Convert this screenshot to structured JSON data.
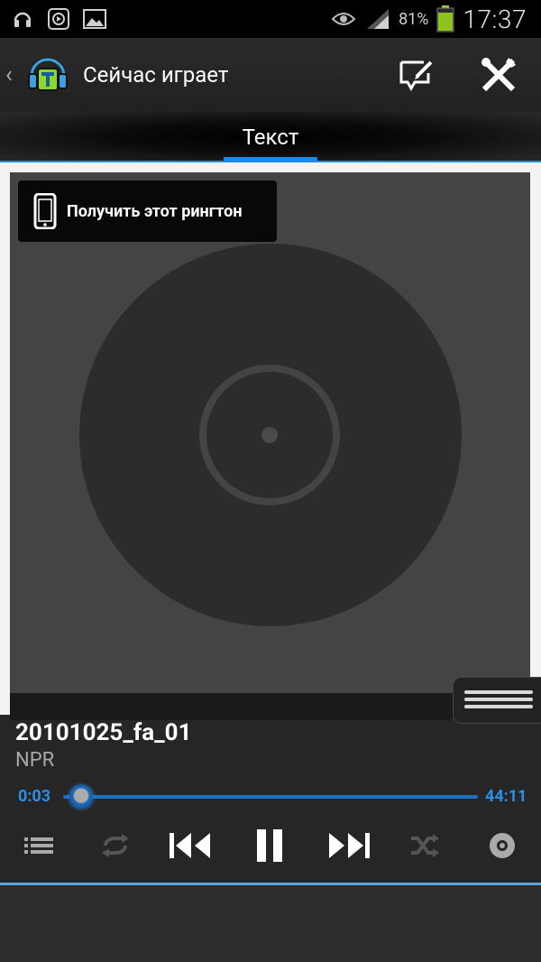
{
  "status_bar": {
    "battery_percent": "81%",
    "time": "17:37",
    "icons": [
      "headphones-app-icon",
      "media-play-icon",
      "image-icon",
      "eye-icon",
      "signal-icon",
      "battery-icon"
    ]
  },
  "action_bar": {
    "title": "Сейчас играет",
    "actions": [
      "edit-icon",
      "tools-icon"
    ]
  },
  "tabs": [
    {
      "label": "Текст",
      "active": true
    }
  ],
  "ringtone_button": {
    "label": "Получить этот рингтон"
  },
  "track": {
    "title": "20101025_fa_01",
    "artist": "NPR"
  },
  "progress": {
    "current": "0:03",
    "total": "44:11",
    "fraction": 0.001
  },
  "controls": [
    "playlist-icon",
    "repeat-icon",
    "previous-icon",
    "pause-icon",
    "next-icon",
    "shuffle-icon",
    "disc-icon"
  ],
  "colors": {
    "accent": "#1d8ae5",
    "background": "#262626"
  }
}
